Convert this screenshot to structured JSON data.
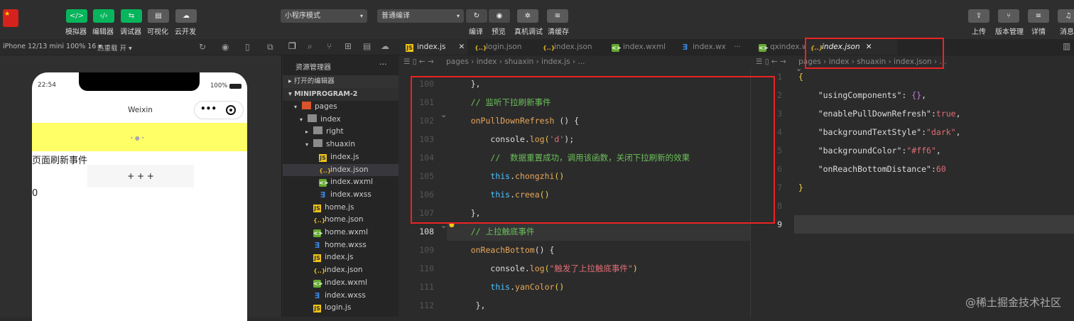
{
  "toolbar": {
    "left_buttons": [
      {
        "label": "模拟器",
        "icon": "</>"
      },
      {
        "label": "编辑器",
        "icon": "‹/›"
      },
      {
        "label": "调试器",
        "icon": "⇆"
      },
      {
        "label": "可视化",
        "icon": "▤"
      },
      {
        "label": "云开发",
        "icon": "☁"
      }
    ],
    "mode_select": "小程序模式",
    "compile_select": "普通编译",
    "mid_buttons": [
      "编译",
      "预览",
      "真机调试",
      "清缓存"
    ],
    "right_buttons": [
      "上传",
      "版本管理",
      "详情",
      "消息"
    ]
  },
  "simulator": {
    "device": "iPhone 12/13 mini 100% 16 ▾",
    "hot_reload": "热重载 开 ▾",
    "time": "22:54",
    "battery": "100%",
    "nav_title": "Weixin",
    "capsule_more": "•••",
    "text1": "页面刷新事件",
    "button": "+ + +",
    "count": "0"
  },
  "explorer": {
    "title": "资源管理器",
    "more": "···",
    "open_editors": "打开的编辑器",
    "project": "MINIPROGRAM-2",
    "items": [
      {
        "name": "pages",
        "type": "pg",
        "depth": 1,
        "arrow": "▾"
      },
      {
        "name": "index",
        "type": "fold",
        "depth": 2,
        "arrow": "▾"
      },
      {
        "name": "right",
        "type": "fold",
        "depth": 3,
        "arrow": "▸"
      },
      {
        "name": "shuaxin",
        "type": "fold",
        "depth": 3,
        "arrow": "▾"
      },
      {
        "name": "index.js",
        "type": "js",
        "depth": 4
      },
      {
        "name": "index.json",
        "type": "json",
        "depth": 4,
        "selected": true
      },
      {
        "name": "index.wxml",
        "type": "wxml",
        "depth": 4
      },
      {
        "name": "index.wxss",
        "type": "wxss",
        "depth": 4
      },
      {
        "name": "home.js",
        "type": "js",
        "depth": 3
      },
      {
        "name": "home.json",
        "type": "json",
        "depth": 3
      },
      {
        "name": "home.wxml",
        "type": "wxml",
        "depth": 3
      },
      {
        "name": "home.wxss",
        "type": "wxss",
        "depth": 3
      },
      {
        "name": "index.js",
        "type": "js",
        "depth": 3
      },
      {
        "name": "index.json",
        "type": "json",
        "depth": 3
      },
      {
        "name": "index.wxml",
        "type": "wxml",
        "depth": 3
      },
      {
        "name": "index.wxss",
        "type": "wxss",
        "depth": 3
      },
      {
        "name": "login.js",
        "type": "js",
        "depth": 3
      }
    ]
  },
  "tabs_left": [
    {
      "label": "index.js",
      "type": "js",
      "active": true,
      "close": "✕"
    },
    {
      "label": "login.json",
      "type": "json"
    },
    {
      "label": "index.json",
      "type": "json"
    },
    {
      "label": "index.wxml",
      "type": "wxml"
    },
    {
      "label": "index.wx",
      "type": "wxss"
    }
  ],
  "tabs_more": "···",
  "tabs_right": [
    {
      "label": "qxindex.wxml",
      "type": "wxml"
    },
    {
      "label": "index.json",
      "type": "json",
      "active": true,
      "close": "✕"
    }
  ],
  "breadcrumb_left": "pages › index › shuaxin › index.js › ...",
  "breadcrumb_right": "pages › index › shuaxin › index.json › ...",
  "editor_left": [
    {
      "n": "100",
      "t": [
        [
          "    ",
          "p"
        ],
        [
          "},",
          "p"
        ]
      ]
    },
    {
      "n": "101",
      "t": [
        [
          "    ",
          "p"
        ],
        [
          "// 监听下拉刷新事件",
          "c"
        ]
      ]
    },
    {
      "n": "102",
      "t": [
        [
          "    ",
          "p"
        ],
        [
          "onPullDownRefresh",
          "f"
        ],
        [
          " () {",
          "p"
        ]
      ]
    },
    {
      "n": "103",
      "t": [
        [
          "        ",
          "p"
        ],
        [
          "console.",
          "p"
        ],
        [
          "log",
          "f"
        ],
        [
          "(",
          "b"
        ],
        [
          "'d'",
          "s"
        ],
        [
          ");",
          "p"
        ]
      ]
    },
    {
      "n": "104",
      "t": [
        [
          "        ",
          "p"
        ],
        [
          "//  数据重置成功，调用该函数，关闭下拉刷新的效果",
          "c"
        ]
      ]
    },
    {
      "n": "105",
      "t": [
        [
          "        ",
          "p"
        ],
        [
          "this",
          "k"
        ],
        [
          ".",
          "p"
        ],
        [
          "chongzhi",
          "f"
        ],
        [
          "()",
          "b"
        ]
      ]
    },
    {
      "n": "106",
      "t": [
        [
          "        ",
          "p"
        ],
        [
          "this",
          "k"
        ],
        [
          ".",
          "p"
        ],
        [
          "creea",
          "f"
        ],
        [
          "()",
          "b"
        ]
      ]
    },
    {
      "n": "107",
      "t": [
        [
          "    ",
          "p"
        ],
        [
          "},",
          "p"
        ]
      ]
    },
    {
      "n": "108",
      "t": [
        [
          "    ",
          "p"
        ],
        [
          "// 上拉触底事件",
          "c"
        ]
      ],
      "current": true
    },
    {
      "n": "109",
      "t": [
        [
          "    ",
          "p"
        ],
        [
          "onReachBottom",
          "f"
        ],
        [
          "() {",
          "p"
        ]
      ]
    },
    {
      "n": "110",
      "t": [
        [
          "        ",
          "p"
        ],
        [
          "console.",
          "p"
        ],
        [
          "log",
          "f"
        ],
        [
          "(",
          "b"
        ],
        [
          "\"触发了上拉触底事件\"",
          "s"
        ],
        [
          ")",
          "b"
        ]
      ]
    },
    {
      "n": "111",
      "t": [
        [
          "        ",
          "p"
        ],
        [
          "this",
          "k"
        ],
        [
          ".",
          "p"
        ],
        [
          "yanColor",
          "f"
        ],
        [
          "()",
          "b"
        ]
      ]
    },
    {
      "n": "112",
      "t": [
        [
          "     ",
          "p"
        ],
        [
          "},",
          "p"
        ]
      ]
    }
  ],
  "editor_right": [
    {
      "n": "1",
      "t": [
        [
          "{",
          "b"
        ]
      ]
    },
    {
      "n": "2",
      "t": [
        [
          "    ",
          "p"
        ],
        [
          "\"usingComponents\"",
          "sk"
        ],
        [
          ": ",
          "p"
        ],
        [
          "{}",
          "pu"
        ],
        [
          ",",
          "p"
        ]
      ]
    },
    {
      "n": "3",
      "t": [
        [
          "    ",
          "p"
        ],
        [
          "\"enablePullDownRefresh\"",
          "sk"
        ],
        [
          ":",
          "p"
        ],
        [
          "true",
          "n"
        ],
        [
          ",",
          "p"
        ]
      ]
    },
    {
      "n": "4",
      "t": [
        [
          "    ",
          "p"
        ],
        [
          "\"backgroundTextStyle\"",
          "sk"
        ],
        [
          ":",
          "p"
        ],
        [
          "\"dark\"",
          "s"
        ],
        [
          ",",
          "p"
        ]
      ]
    },
    {
      "n": "5",
      "t": [
        [
          "    ",
          "p"
        ],
        [
          "\"backgroundColor\"",
          "sk"
        ],
        [
          ":",
          "p"
        ],
        [
          "\"#ff6\"",
          "s"
        ],
        [
          ",",
          "p"
        ]
      ]
    },
    {
      "n": "6",
      "t": [
        [
          "    ",
          "p"
        ],
        [
          "\"onReachBottomDistance\"",
          "sk"
        ],
        [
          ":",
          "p"
        ],
        [
          "60",
          "n"
        ]
      ]
    },
    {
      "n": "7",
      "t": [
        [
          "}",
          "b"
        ]
      ]
    },
    {
      "n": "8",
      "t": []
    },
    {
      "n": "9",
      "t": [],
      "current": true
    }
  ],
  "watermark": "@稀土掘金技术社区",
  "colors": {
    "accent_green": "#07b55c",
    "highlight": "#e22222",
    "pull_bg": "#ffff66"
  }
}
